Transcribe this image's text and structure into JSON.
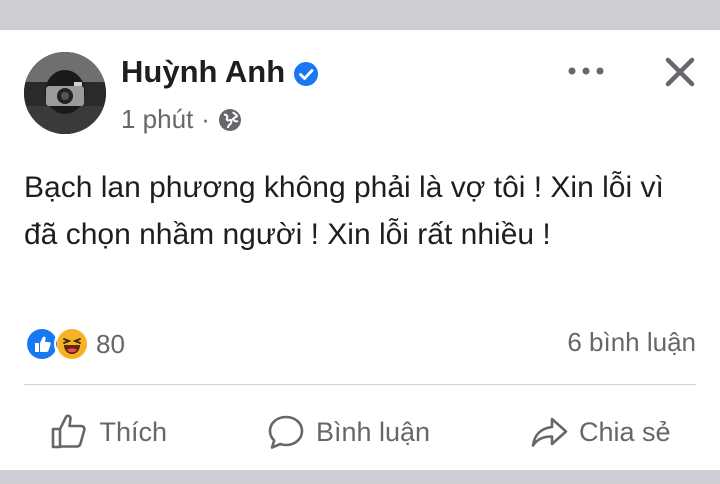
{
  "post": {
    "author": "Huỳnh Anh",
    "verified": true,
    "time": "1 phút",
    "separator": "·",
    "audience_icon": "globe-icon",
    "text": "Bạch lan phương không phải là vợ tôi ! Xin lỗi vì đã chọn nhầm người ! Xin lỗi rất nhiều !"
  },
  "header_actions": {
    "more_icon": "more-horizontal-icon",
    "close_icon": "close-icon"
  },
  "stats": {
    "reaction_icons": [
      "like-reaction-icon",
      "haha-reaction-icon"
    ],
    "reaction_count": "80",
    "comment_count": "6 bình luận"
  },
  "actions": {
    "like": "Thích",
    "comment": "Bình luận",
    "share": "Chia sẻ"
  },
  "colors": {
    "accent": "#1877f2",
    "text": "#1c1e21",
    "secondary": "#65676b",
    "background": "#ccced3"
  }
}
